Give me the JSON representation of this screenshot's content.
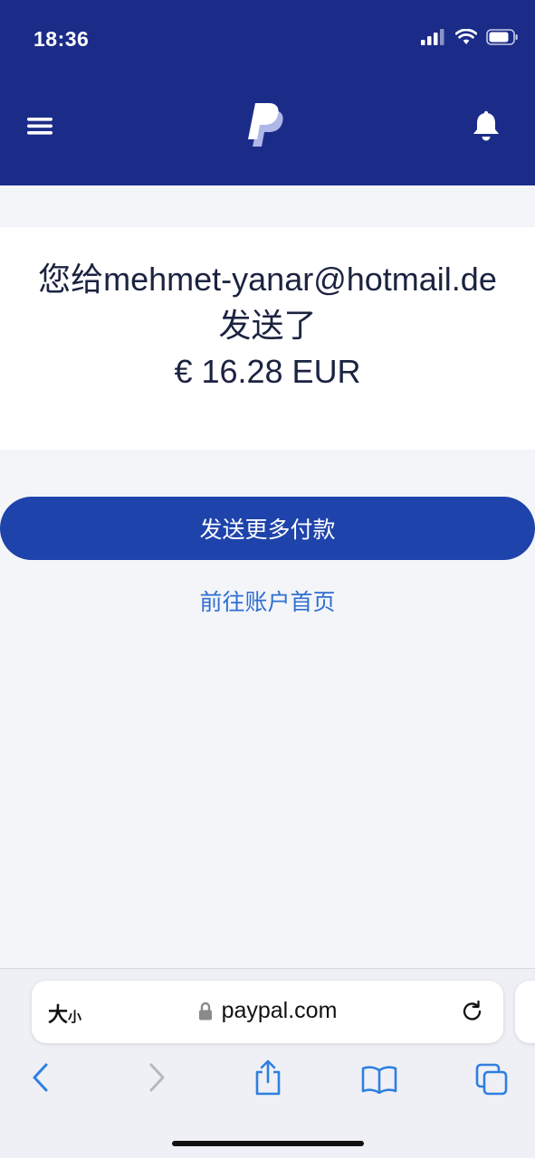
{
  "status_bar": {
    "time": "18:36",
    "icons": [
      "cellular-signal-icon",
      "wifi-icon",
      "battery-icon"
    ]
  },
  "header": {
    "menu_icon": "hamburger-menu-icon",
    "logo": "paypal-logo",
    "notification_icon": "bell-icon",
    "background_color": "#1b2c88"
  },
  "confirmation": {
    "message": "您给mehmet-yanar@hotmail.de发送了",
    "amount": "€ 16.28 EUR"
  },
  "actions": {
    "send_more_label": "发送更多付款",
    "go_home_label": "前往账户首页",
    "primary_color": "#1e43ab",
    "link_color": "#2f6fd0"
  },
  "browser": {
    "text_size_label_large": "大",
    "text_size_label_small": "小",
    "url": "paypal.com",
    "lock_icon": "lock-icon",
    "reload_icon": "reload-icon",
    "toolbar": [
      "back-icon",
      "forward-icon",
      "share-icon",
      "bookmarks-icon",
      "tabs-icon"
    ]
  }
}
